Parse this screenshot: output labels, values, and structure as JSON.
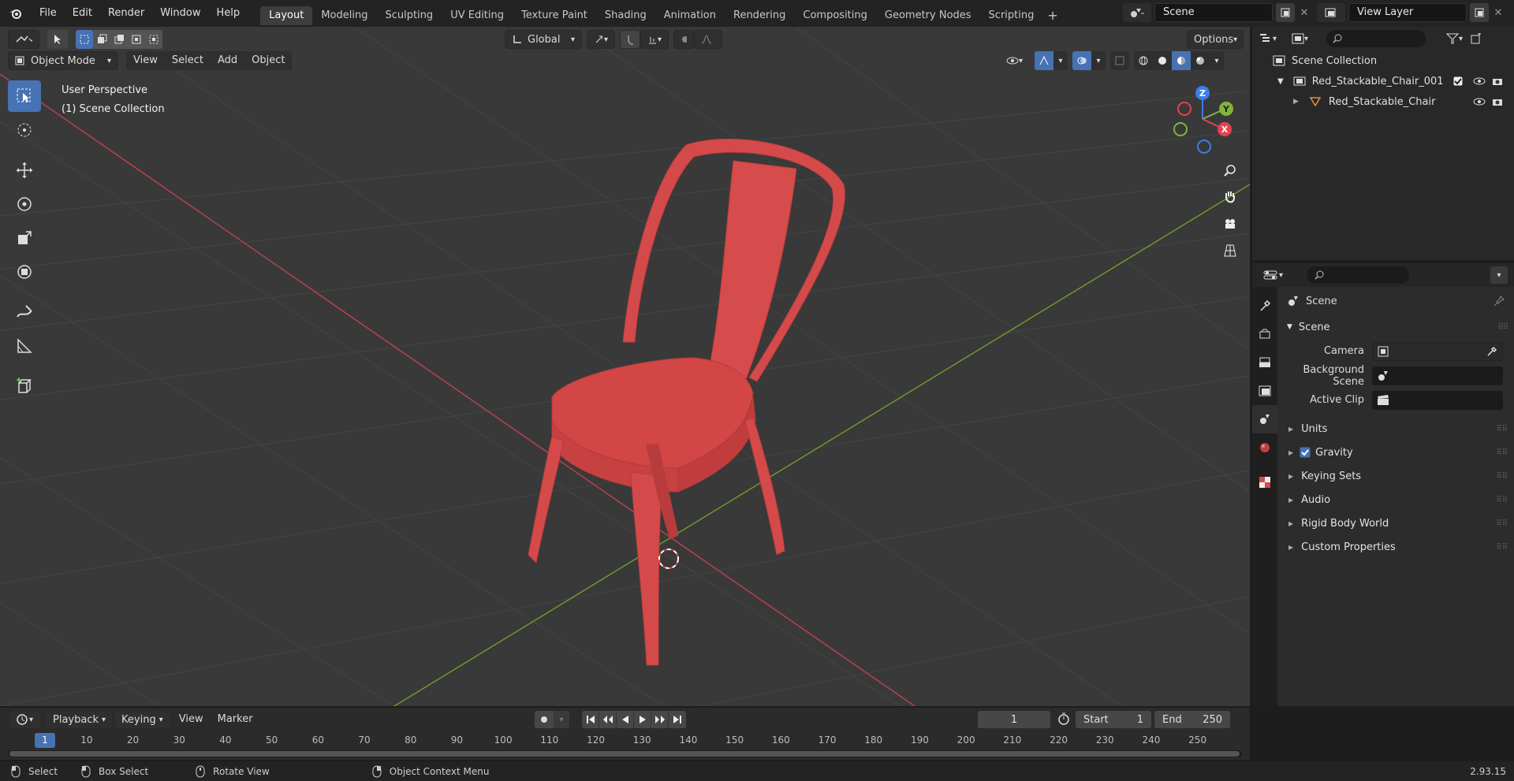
{
  "topbar": {
    "menus": [
      "File",
      "Edit",
      "Render",
      "Window",
      "Help"
    ],
    "workspaces": [
      "Layout",
      "Modeling",
      "Sculpting",
      "UV Editing",
      "Texture Paint",
      "Shading",
      "Animation",
      "Rendering",
      "Compositing",
      "Geometry Nodes",
      "Scripting"
    ],
    "add_tab": "+",
    "scene_value": "Scene",
    "view_layer_value": "View Layer"
  },
  "viewport": {
    "transform_orientation": "Global",
    "options_label": "Options",
    "mode": "Object Mode",
    "menus": [
      "View",
      "Select",
      "Add",
      "Object"
    ],
    "perspective_label": "User Perspective",
    "collection_label": "(1) Scene Collection",
    "gizmo": {
      "x": "X",
      "y": "Y",
      "z": "Z"
    }
  },
  "outliner": {
    "root": "Scene Collection",
    "collection": "Red_Stackable_Chair_001",
    "object": "Red_Stackable_Chair"
  },
  "properties": {
    "context_label": "Scene",
    "panel_title": "Scene",
    "camera_label": "Camera",
    "background_scene_label": "Background Scene",
    "active_clip_label": "Active Clip",
    "sections": [
      "Units",
      "Gravity",
      "Keying Sets",
      "Audio",
      "Rigid Body World",
      "Custom Properties"
    ],
    "gravity_checked": true
  },
  "timeline": {
    "menus": [
      "Playback",
      "Keying",
      "View",
      "Marker"
    ],
    "current_frame": "1",
    "start_label": "Start",
    "start_value": "1",
    "end_label": "End",
    "end_value": "250",
    "ruler": [
      "1",
      "10",
      "20",
      "30",
      "40",
      "50",
      "60",
      "70",
      "80",
      "90",
      "100",
      "110",
      "120",
      "130",
      "140",
      "150",
      "160",
      "170",
      "180",
      "190",
      "200",
      "210",
      "220",
      "230",
      "240",
      "250"
    ]
  },
  "statusbar": {
    "select": "Select",
    "box_select": "Box Select",
    "rotate_view": "Rotate View",
    "context_menu": "Object Context Menu",
    "version": "2.93.15"
  },
  "colors": {
    "accent": "#4772b3",
    "chair": "#d44a4a",
    "x_axis": "#b5434b",
    "y_axis": "#6d9a2a"
  }
}
